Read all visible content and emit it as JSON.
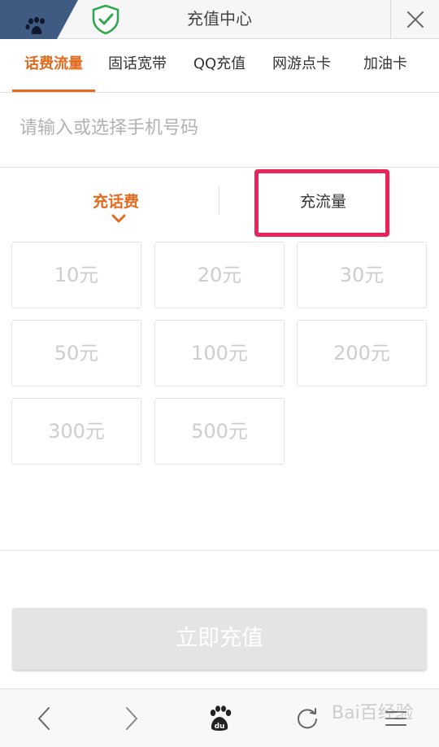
{
  "header": {
    "title": "充值中心",
    "accent": "#2fa84f"
  },
  "categories": [
    {
      "label": "话费流量",
      "active": true
    },
    {
      "label": "固话宽带",
      "active": false
    },
    {
      "label": "QQ充值",
      "active": false
    },
    {
      "label": "网游点卡",
      "active": false
    },
    {
      "label": "加油卡",
      "active": false
    }
  ],
  "phone": {
    "placeholder": "请输入或选择手机号码",
    "value": ""
  },
  "subtabs": [
    {
      "label": "充话费",
      "active": true
    },
    {
      "label": "充流量",
      "active": false
    }
  ],
  "amounts": [
    "10元",
    "20元",
    "30元",
    "50元",
    "100元",
    "200元",
    "300元",
    "500元"
  ],
  "recharge_button": "立即充值",
  "watermark": "Bai百经验",
  "colors": {
    "accent": "#e36a1e",
    "highlight": "#e8245a",
    "disabled": "#e4e4e4"
  }
}
